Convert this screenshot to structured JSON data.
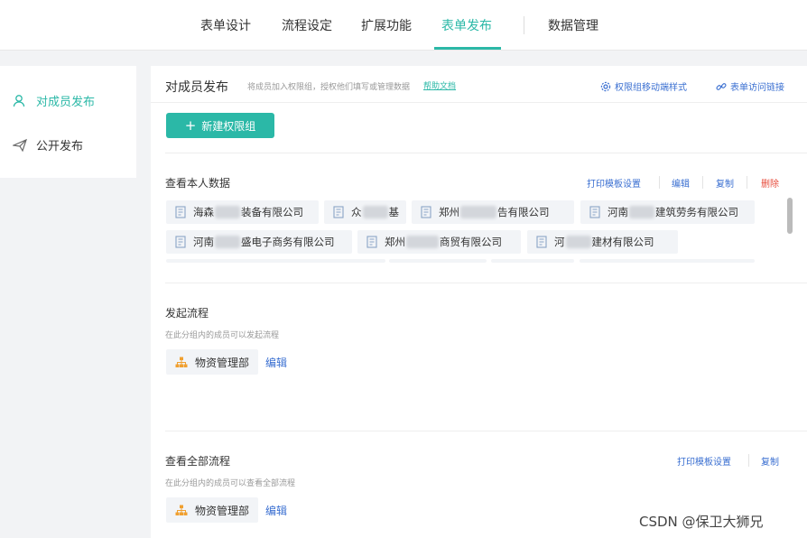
{
  "top_tabs": [
    {
      "label": "表单设计"
    },
    {
      "label": "流程设定"
    },
    {
      "label": "扩展功能"
    },
    {
      "label": "表单发布"
    },
    {
      "label": "数据管理"
    }
  ],
  "sidebar": {
    "items": [
      {
        "label": "对成员发布",
        "active": true
      },
      {
        "label": "公开发布",
        "active": false
      }
    ]
  },
  "header": {
    "title": "对成员发布",
    "desc": "将成员加入权限组，授权他们填写或管理数据",
    "help": "帮助文档",
    "mobile_style": "权限组移动端样式",
    "access_link": "表单访问链接"
  },
  "new_group_button": "新建权限组",
  "groups": [
    {
      "title": "查看本人数据",
      "actions": {
        "print": "打印模板设置",
        "edit": "编辑",
        "copy": "复制",
        "delete": "删除"
      },
      "chips": [
        {
          "pre": "海森",
          "post": "装备有限公司"
        },
        {
          "pre": "众",
          "post": "基"
        },
        {
          "pre": "郑州",
          "post": "告有限公司"
        },
        {
          "pre": "河南",
          "post": "建筑劳务有限公司"
        },
        {
          "pre": "河南",
          "post": "盛电子商务有限公司"
        },
        {
          "pre": "郑州",
          "post": "商贸有限公司"
        },
        {
          "pre": "河",
          "post": "建材有限公司"
        }
      ]
    },
    {
      "title": "发起流程",
      "desc": "在此分组内的成员可以发起流程",
      "dept": "物资管理部",
      "edit": "编辑"
    },
    {
      "title": "查看全部流程",
      "desc": "在此分组内的成员可以查看全部流程",
      "actions": {
        "print": "打印模板设置",
        "copy": "复制"
      },
      "dept": "物资管理部",
      "edit": "编辑"
    }
  ],
  "watermark": "CSDN @保卫大狮兄",
  "colors": {
    "accent": "#2bb8a7",
    "link": "#3a6fd1",
    "danger": "#e74c3c"
  }
}
